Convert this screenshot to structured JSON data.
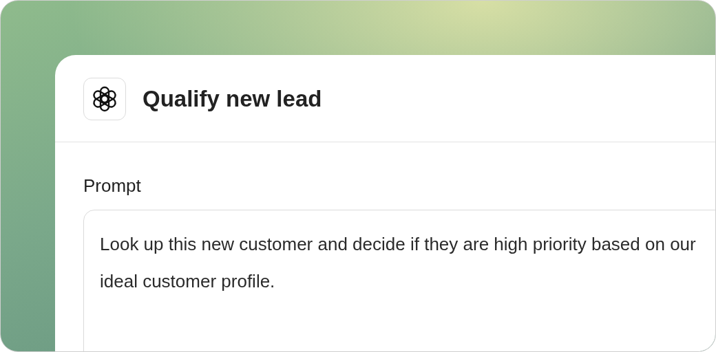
{
  "card": {
    "title": "Qualify new lead"
  },
  "prompt": {
    "label": "Prompt",
    "value": "Look up this new customer and decide if they are high priority based on our ideal customer profile."
  }
}
